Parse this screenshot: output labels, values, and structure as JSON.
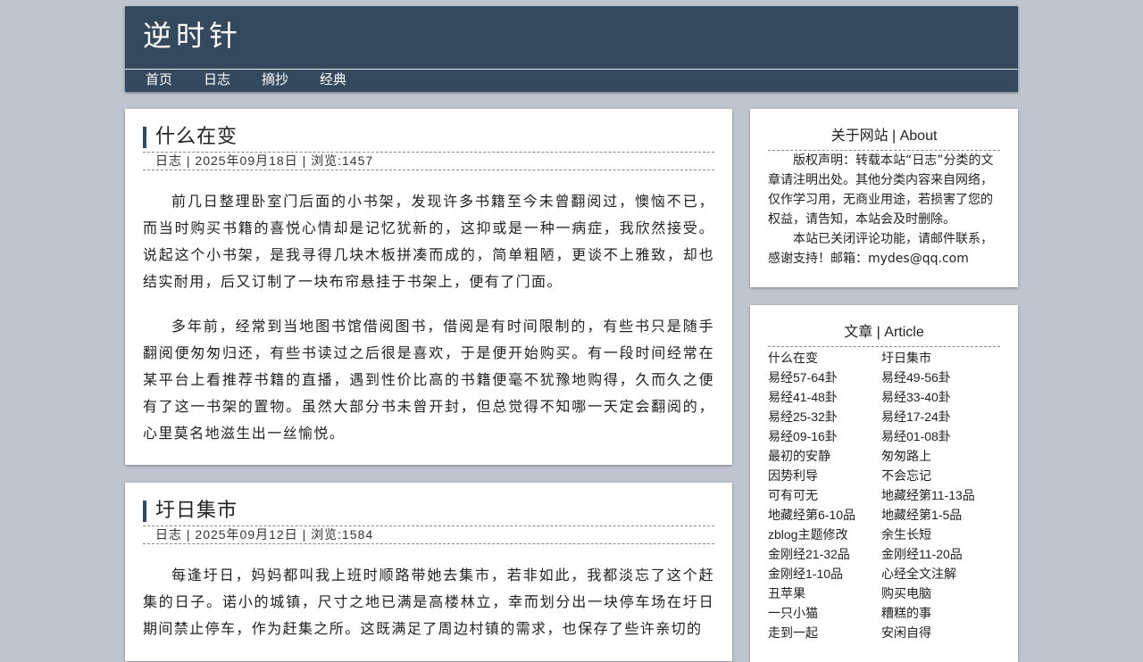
{
  "site": {
    "title": "逆时针"
  },
  "nav": [
    "首页",
    "日志",
    "摘抄",
    "经典"
  ],
  "posts": [
    {
      "title": "什么在变",
      "meta": "日志 | 2025年09月18日 | 浏览:1457",
      "paragraphs": [
        "前几日整理卧室门后面的小书架，发现许多书籍至今未曾翻阅过，懊恼不已，而当时购买书籍的喜悦心情却是记忆犹新的，这抑或是一种一病症，我欣然接受。说起这个小书架，是我寻得几块木板拼凑而成的，简单粗陋，更谈不上雅致，却也结实耐用，后又订制了一块布帘悬挂于书架上，便有了门面。",
        "多年前，经常到当地图书馆借阅图书，借阅是有时间限制的，有些书只是随手翻阅便匆匆归还，有些书读过之后很是喜欢，于是便开始购买。有一段时间经常在某平台上看推荐书籍的直播，遇到性价比高的书籍便毫不犹豫地购得，久而久之便有了这一书架的置物。虽然大部分书未曾开封，但总觉得不知哪一天定会翻阅的，心里莫名地滋生出一丝愉悦。"
      ]
    },
    {
      "title": "圩日集市",
      "meta": "日志 | 2025年09月12日 | 浏览:1584",
      "paragraphs": [
        "每逢圩日，妈妈都叫我上班时顺路带她去集市，若非如此，我都淡忘了这个赶集的日子。诺小的城镇，尺寸之地已满是高楼林立，幸而划分出一块停车场在圩日期间禁止停车，作为赶集之所。这既满足了周边村镇的需求，也保存了些许亲切的"
      ]
    }
  ],
  "about": {
    "title": "关于网站 | About",
    "paragraphs": [
      "版权声明：转载本站“日志”分类的文章请注明出处。其他分类内容来自网络，仅作学习用，无商业用途，若损害了您的权益，请告知，本站会及时删除。",
      "本站已关闭评论功能，请邮件联系，感谢支持！邮箱：mydes@qq.com"
    ]
  },
  "articles": {
    "title": "文章 | Article",
    "items": [
      "什么在变",
      "圩日集市",
      "易经57-64卦",
      "易经49-56卦",
      "易经41-48卦",
      "易经33-40卦",
      "易经25-32卦",
      "易经17-24卦",
      "易经09-16卦",
      "易经01-08卦",
      "最初的安静",
      "匆匆路上",
      "因势利导",
      "不会忘记",
      "可有可无",
      "地藏经第11-13品",
      "地藏经第6-10品",
      "地藏经第1-5品",
      "zblog主题修改",
      "余生长短",
      "金刚经21-32品",
      "金刚经11-20品",
      "金刚经1-10品",
      "心经全文注解",
      "丑苹果",
      "购买电脑",
      "一只小猫",
      "糟糕的事",
      "走到一起",
      "安闲自得"
    ]
  }
}
